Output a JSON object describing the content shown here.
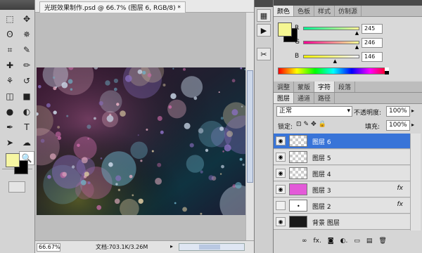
{
  "document": {
    "tab_title": "光斑效果制作.psd @ 66.7% (图层 6, RGB/8) *",
    "zoom": "66.67%",
    "doc_size": "文档:703.1K/3.26M"
  },
  "tools": {
    "items": [
      "marquee-icon",
      "move-icon",
      "lasso-icon",
      "magic-wand-icon",
      "crop-icon",
      "eyedropper-icon",
      "healing-brush-icon",
      "brush-icon",
      "clone-stamp-icon",
      "history-brush-icon",
      "eraser-icon",
      "gradient-icon",
      "blur-icon",
      "dodge-icon",
      "pen-icon",
      "type-icon",
      "path-select-icon",
      "shape-icon",
      "hand-icon",
      "zoom-icon"
    ],
    "glyphs": [
      "⬚",
      "✥",
      "ʘ",
      "✵",
      "⌗",
      "✎",
      "✚",
      "✏",
      "⚘",
      "↺",
      "◫",
      "■",
      "●",
      "◐",
      "✒",
      "T",
      "➤",
      "☁",
      "✋",
      "🔍"
    ],
    "foreground_color": "#f6f6a2",
    "background_color": "#000000"
  },
  "color_panel": {
    "tabs": [
      "颜色",
      "色板",
      "样式",
      "仿制源"
    ],
    "swatch": "#f5f692",
    "channels": [
      {
        "label": "R",
        "value": "245",
        "slider_pct": 96
      },
      {
        "label": "G",
        "value": "246",
        "slider_pct": 96
      },
      {
        "label": "B",
        "value": "146",
        "slider_pct": 57
      }
    ]
  },
  "adjust_panel": {
    "tabs": [
      "调整",
      "蒙版",
      "字符",
      "段落"
    ]
  },
  "layers_panel": {
    "tabs": [
      "图层",
      "通道",
      "路径"
    ],
    "blend_mode": "正常",
    "opacity_label": "不透明度:",
    "opacity_value": "100%",
    "lock_label": "锁定:",
    "fill_label": "填充:",
    "fill_value": "100%",
    "layers": [
      {
        "name": "图层 6",
        "fx": "",
        "thumb": "checker",
        "selected": true,
        "visible": true
      },
      {
        "name": "图层 5",
        "fx": "",
        "thumb": "checker",
        "selected": false,
        "visible": true
      },
      {
        "name": "图层 4",
        "fx": "",
        "thumb": "checker",
        "selected": false,
        "visible": true
      },
      {
        "name": "图层 3",
        "fx": "fx",
        "thumb": "magenta",
        "selected": false,
        "visible": true
      },
      {
        "name": "图层 2",
        "fx": "fx",
        "thumb": "dots",
        "selected": false,
        "visible": false
      },
      {
        "name": "背景 图层",
        "fx": "",
        "thumb": "black",
        "selected": false,
        "visible": true
      }
    ],
    "bottom_icons": [
      "link-icon",
      "fx-icon",
      "mask-icon",
      "adjustment-icon",
      "group-icon",
      "new-layer-icon",
      "trash-icon"
    ],
    "bottom_glyphs": [
      "∞",
      "fx.",
      "◙",
      "◐.",
      "▭",
      "▤",
      "🗑"
    ]
  },
  "colors": {
    "selection": "#3874d8",
    "panel_bg": "#d6d6d6"
  }
}
